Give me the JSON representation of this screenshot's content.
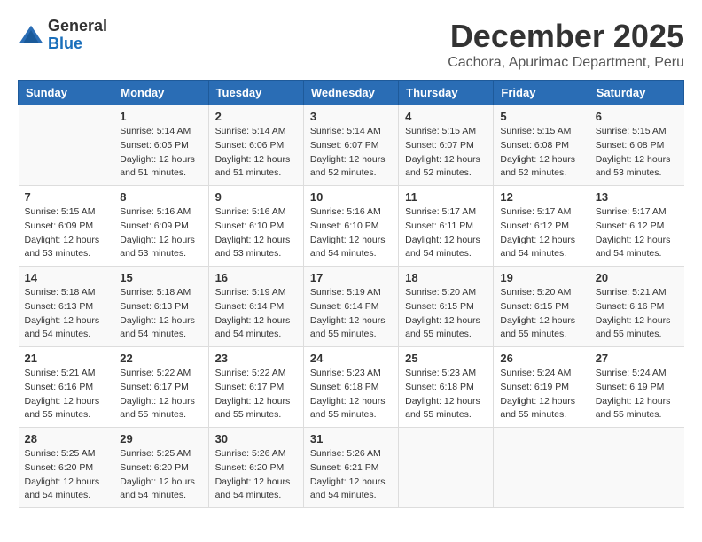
{
  "header": {
    "logo_general": "General",
    "logo_blue": "Blue",
    "month_title": "December 2025",
    "subtitle": "Cachora, Apurimac Department, Peru"
  },
  "days_of_week": [
    "Sunday",
    "Monday",
    "Tuesday",
    "Wednesday",
    "Thursday",
    "Friday",
    "Saturday"
  ],
  "weeks": [
    [
      {
        "day": "",
        "sunrise": "",
        "sunset": "",
        "daylight": ""
      },
      {
        "day": "1",
        "sunrise": "Sunrise: 5:14 AM",
        "sunset": "Sunset: 6:05 PM",
        "daylight": "Daylight: 12 hours and 51 minutes."
      },
      {
        "day": "2",
        "sunrise": "Sunrise: 5:14 AM",
        "sunset": "Sunset: 6:06 PM",
        "daylight": "Daylight: 12 hours and 51 minutes."
      },
      {
        "day": "3",
        "sunrise": "Sunrise: 5:14 AM",
        "sunset": "Sunset: 6:07 PM",
        "daylight": "Daylight: 12 hours and 52 minutes."
      },
      {
        "day": "4",
        "sunrise": "Sunrise: 5:15 AM",
        "sunset": "Sunset: 6:07 PM",
        "daylight": "Daylight: 12 hours and 52 minutes."
      },
      {
        "day": "5",
        "sunrise": "Sunrise: 5:15 AM",
        "sunset": "Sunset: 6:08 PM",
        "daylight": "Daylight: 12 hours and 52 minutes."
      },
      {
        "day": "6",
        "sunrise": "Sunrise: 5:15 AM",
        "sunset": "Sunset: 6:08 PM",
        "daylight": "Daylight: 12 hours and 53 minutes."
      }
    ],
    [
      {
        "day": "7",
        "sunrise": "Sunrise: 5:15 AM",
        "sunset": "Sunset: 6:09 PM",
        "daylight": "Daylight: 12 hours and 53 minutes."
      },
      {
        "day": "8",
        "sunrise": "Sunrise: 5:16 AM",
        "sunset": "Sunset: 6:09 PM",
        "daylight": "Daylight: 12 hours and 53 minutes."
      },
      {
        "day": "9",
        "sunrise": "Sunrise: 5:16 AM",
        "sunset": "Sunset: 6:10 PM",
        "daylight": "Daylight: 12 hours and 53 minutes."
      },
      {
        "day": "10",
        "sunrise": "Sunrise: 5:16 AM",
        "sunset": "Sunset: 6:10 PM",
        "daylight": "Daylight: 12 hours and 54 minutes."
      },
      {
        "day": "11",
        "sunrise": "Sunrise: 5:17 AM",
        "sunset": "Sunset: 6:11 PM",
        "daylight": "Daylight: 12 hours and 54 minutes."
      },
      {
        "day": "12",
        "sunrise": "Sunrise: 5:17 AM",
        "sunset": "Sunset: 6:12 PM",
        "daylight": "Daylight: 12 hours and 54 minutes."
      },
      {
        "day": "13",
        "sunrise": "Sunrise: 5:17 AM",
        "sunset": "Sunset: 6:12 PM",
        "daylight": "Daylight: 12 hours and 54 minutes."
      }
    ],
    [
      {
        "day": "14",
        "sunrise": "Sunrise: 5:18 AM",
        "sunset": "Sunset: 6:13 PM",
        "daylight": "Daylight: 12 hours and 54 minutes."
      },
      {
        "day": "15",
        "sunrise": "Sunrise: 5:18 AM",
        "sunset": "Sunset: 6:13 PM",
        "daylight": "Daylight: 12 hours and 54 minutes."
      },
      {
        "day": "16",
        "sunrise": "Sunrise: 5:19 AM",
        "sunset": "Sunset: 6:14 PM",
        "daylight": "Daylight: 12 hours and 54 minutes."
      },
      {
        "day": "17",
        "sunrise": "Sunrise: 5:19 AM",
        "sunset": "Sunset: 6:14 PM",
        "daylight": "Daylight: 12 hours and 55 minutes."
      },
      {
        "day": "18",
        "sunrise": "Sunrise: 5:20 AM",
        "sunset": "Sunset: 6:15 PM",
        "daylight": "Daylight: 12 hours and 55 minutes."
      },
      {
        "day": "19",
        "sunrise": "Sunrise: 5:20 AM",
        "sunset": "Sunset: 6:15 PM",
        "daylight": "Daylight: 12 hours and 55 minutes."
      },
      {
        "day": "20",
        "sunrise": "Sunrise: 5:21 AM",
        "sunset": "Sunset: 6:16 PM",
        "daylight": "Daylight: 12 hours and 55 minutes."
      }
    ],
    [
      {
        "day": "21",
        "sunrise": "Sunrise: 5:21 AM",
        "sunset": "Sunset: 6:16 PM",
        "daylight": "Daylight: 12 hours and 55 minutes."
      },
      {
        "day": "22",
        "sunrise": "Sunrise: 5:22 AM",
        "sunset": "Sunset: 6:17 PM",
        "daylight": "Daylight: 12 hours and 55 minutes."
      },
      {
        "day": "23",
        "sunrise": "Sunrise: 5:22 AM",
        "sunset": "Sunset: 6:17 PM",
        "daylight": "Daylight: 12 hours and 55 minutes."
      },
      {
        "day": "24",
        "sunrise": "Sunrise: 5:23 AM",
        "sunset": "Sunset: 6:18 PM",
        "daylight": "Daylight: 12 hours and 55 minutes."
      },
      {
        "day": "25",
        "sunrise": "Sunrise: 5:23 AM",
        "sunset": "Sunset: 6:18 PM",
        "daylight": "Daylight: 12 hours and 55 minutes."
      },
      {
        "day": "26",
        "sunrise": "Sunrise: 5:24 AM",
        "sunset": "Sunset: 6:19 PM",
        "daylight": "Daylight: 12 hours and 55 minutes."
      },
      {
        "day": "27",
        "sunrise": "Sunrise: 5:24 AM",
        "sunset": "Sunset: 6:19 PM",
        "daylight": "Daylight: 12 hours and 55 minutes."
      }
    ],
    [
      {
        "day": "28",
        "sunrise": "Sunrise: 5:25 AM",
        "sunset": "Sunset: 6:20 PM",
        "daylight": "Daylight: 12 hours and 54 minutes."
      },
      {
        "day": "29",
        "sunrise": "Sunrise: 5:25 AM",
        "sunset": "Sunset: 6:20 PM",
        "daylight": "Daylight: 12 hours and 54 minutes."
      },
      {
        "day": "30",
        "sunrise": "Sunrise: 5:26 AM",
        "sunset": "Sunset: 6:20 PM",
        "daylight": "Daylight: 12 hours and 54 minutes."
      },
      {
        "day": "31",
        "sunrise": "Sunrise: 5:26 AM",
        "sunset": "Sunset: 6:21 PM",
        "daylight": "Daylight: 12 hours and 54 minutes."
      },
      {
        "day": "",
        "sunrise": "",
        "sunset": "",
        "daylight": ""
      },
      {
        "day": "",
        "sunrise": "",
        "sunset": "",
        "daylight": ""
      },
      {
        "day": "",
        "sunrise": "",
        "sunset": "",
        "daylight": ""
      }
    ]
  ]
}
